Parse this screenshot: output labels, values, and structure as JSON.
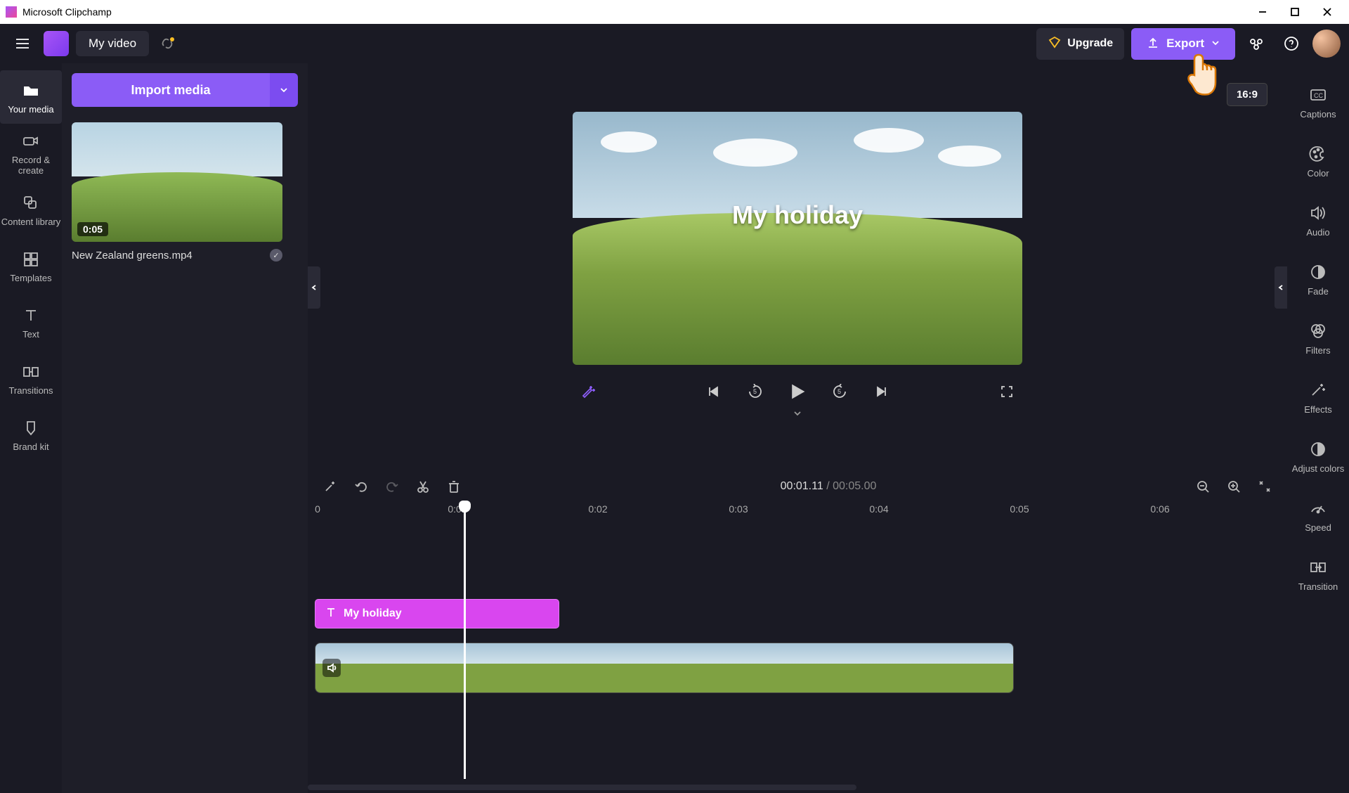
{
  "titlebar": {
    "app_name": "Microsoft Clipchamp"
  },
  "toolbar": {
    "project_name": "My video",
    "upgrade_label": "Upgrade",
    "export_label": "Export"
  },
  "leftrail": {
    "items": [
      {
        "label": "Your media"
      },
      {
        "label": "Record & create"
      },
      {
        "label": "Content library"
      },
      {
        "label": "Templates"
      },
      {
        "label": "Text"
      },
      {
        "label": "Transitions"
      },
      {
        "label": "Brand kit"
      }
    ]
  },
  "media_panel": {
    "import_label": "Import media",
    "thumb_duration": "0:05",
    "thumb_name": "New Zealand greens.mp4"
  },
  "preview": {
    "aspect": "16:9",
    "overlay_text": "My holiday"
  },
  "timeline": {
    "current_time": "00:01.11",
    "total_time": "00:05.00",
    "ruler": [
      "0",
      "0:01",
      "0:02",
      "0:03",
      "0:04",
      "0:05",
      "0:06"
    ],
    "text_clip_label": "My holiday"
  },
  "rightrail": {
    "items": [
      {
        "label": "Captions"
      },
      {
        "label": "Color"
      },
      {
        "label": "Audio"
      },
      {
        "label": "Fade"
      },
      {
        "label": "Filters"
      },
      {
        "label": "Effects"
      },
      {
        "label": "Adjust colors"
      },
      {
        "label": "Speed"
      },
      {
        "label": "Transition"
      }
    ]
  }
}
